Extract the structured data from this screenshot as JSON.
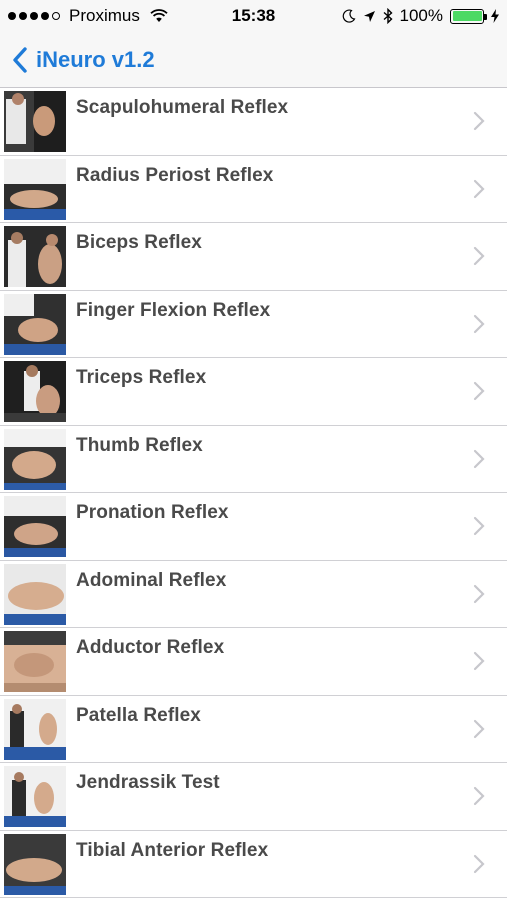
{
  "status_bar": {
    "carrier": "Proximus",
    "time": "15:38",
    "battery": "100%",
    "signal_bars_filled": 4,
    "signal_bars_total": 5
  },
  "nav": {
    "back_label": "iNeuro v1.2",
    "back_icon": "chevron-left-icon",
    "accent_color": "#1f7bd8"
  },
  "list": {
    "items": [
      {
        "label": "Scapulohumeral Reflex"
      },
      {
        "label": "Radius Periost Reflex"
      },
      {
        "label": "Biceps Reflex"
      },
      {
        "label": "Finger Flexion Reflex"
      },
      {
        "label": "Triceps Reflex"
      },
      {
        "label": "Thumb Reflex"
      },
      {
        "label": "Pronation Reflex"
      },
      {
        "label": "Adominal Reflex"
      },
      {
        "label": "Adductor Reflex"
      },
      {
        "label": "Patella Reflex"
      },
      {
        "label": "Jendrassik Test"
      },
      {
        "label": "Tibial Anterior Reflex"
      }
    ]
  }
}
